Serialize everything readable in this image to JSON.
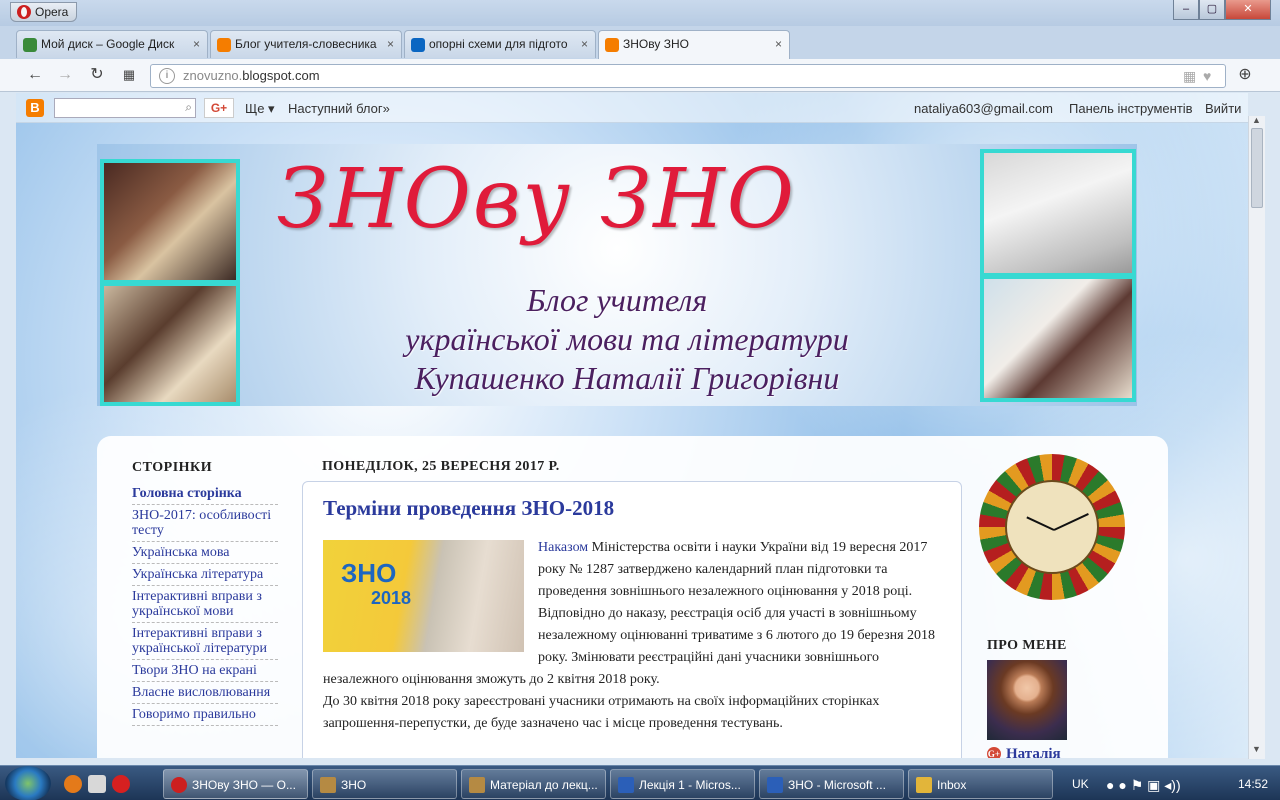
{
  "browser": {
    "name": "Opera",
    "tabs": [
      {
        "label": "Мой диск – Google Диск",
        "color": "#3a8a3a"
      },
      {
        "label": "Блог учителя-словесника",
        "color": "#f57d00"
      },
      {
        "label": "опорні схеми для підгото",
        "color": "#0a66c2"
      },
      {
        "label": "ЗНОву ЗНО",
        "color": "#f57d00"
      }
    ],
    "url_prefix": "znovuzno.",
    "url_domain": "blogspot.com"
  },
  "blogger_bar": {
    "search_placeholder": "",
    "more": "Ще ▾",
    "next_blog": "Наступний блог»",
    "email": "nataliya603@gmail.com",
    "dashboard": "Панель інструментів",
    "logout": "Вийти"
  },
  "header": {
    "title": "ЗНОву ЗНО",
    "sub1": "Блог учителя",
    "sub2": "української мови та літератури",
    "sub3": "Купашенко Наталії Григорівни"
  },
  "sidebar": {
    "heading": "СТОРІНКИ",
    "items": [
      "Головна сторінка",
      "ЗНО-2017: особливості тесту",
      "Українська мова",
      "Українська література",
      "Інтерактивні вправи з української мови",
      "Інтерактивні вправи з української літератури",
      "Твори ЗНО на екрані",
      "Власне висловлювання",
      "Говоримо правильно"
    ]
  },
  "post": {
    "date": "ПОНЕДІЛОК, 25 ВЕРЕСНЯ 2017 Р.",
    "title": "Терміни проведення ЗНО-2018",
    "image_zno": "ЗНО",
    "image_year": "2018",
    "link": "Наказом",
    "p1": " Міністерства освіти і науки України від 19 вересня 2017 року № 1287 затверджено календарний план підготовки та проведення зовнішнього незалежного оцінювання у 2018 році.",
    "p2": "Відповідно до наказу, реєстрація осіб для участі в зовнішньому незалежному оцінюванні триватиме з 6 лютого до 19 березня 2018 року. Змінювати реєстраційні дані учасники зовнішнього незалежного оцінювання зможуть до 2 квітня 2018 року.",
    "p3": "До 30 квітня 2018 року зареєстровані учасники отримають на своїх інформаційних сторінках запрошення-перепустки, де буде зазначено час і місце проведення тестувань."
  },
  "about": {
    "heading": "ПРО МЕНЕ",
    "name": "Наталія"
  },
  "taskbar": {
    "tasks": [
      {
        "label": "ЗНОву ЗНО — O...",
        "color": "#cc1f1f"
      },
      {
        "label": "ЗНО",
        "color": "#b58a43"
      },
      {
        "label": "Матеріал до лекц...",
        "color": "#b58a43"
      },
      {
        "label": "Лекція 1 - Micros...",
        "color": "#2b5fb8"
      },
      {
        "label": "ЗНО - Microsoft ...",
        "color": "#2b5fb8"
      },
      {
        "label": "Inbox",
        "color": "#e2b53a"
      }
    ],
    "lang": "UK",
    "time": "14:52"
  }
}
